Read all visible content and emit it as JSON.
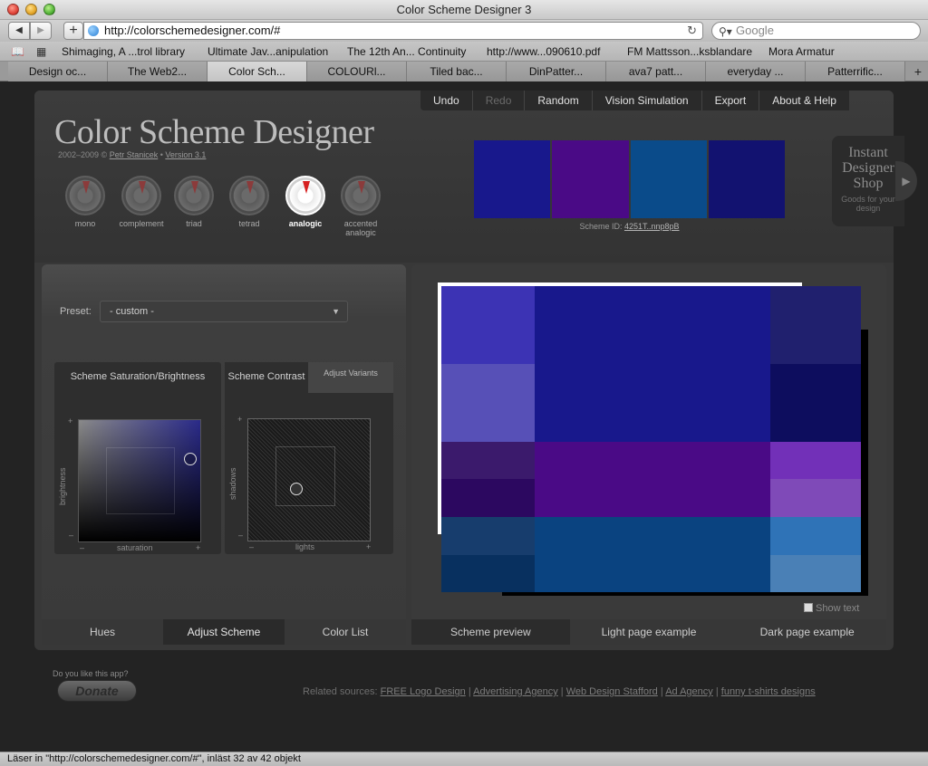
{
  "browser": {
    "window_title": "Color Scheme Designer 3",
    "url": "http://colorschemedesigner.com/#",
    "search_placeholder": "Google",
    "bookmarks": [
      "Shimaging, A ...trol library",
      "Ultimate Jav...anipulation",
      "The 12th An... Continuity",
      "http://www...090610.pdf",
      "FM Mattsson...ksblandare",
      "Mora Armatur"
    ],
    "tabs": [
      "Design oc...",
      "The Web2...",
      "Color Sch...",
      "COLOURl...",
      "Tiled bac...",
      "DinPatter...",
      "ava7 patt...",
      "everyday ...",
      "Patterrific..."
    ],
    "status": "Läser in \"http://colorschemedesigner.com/#\", inläst 32 av 42 objekt"
  },
  "menu": {
    "items": [
      "Undo",
      "Redo",
      "Random",
      "Vision Simulation",
      "Export",
      "About & Help"
    ]
  },
  "header": {
    "logo": "Color Scheme Designer",
    "credits_prefix": "2002–2009 ©",
    "author": "Petr Stanicek",
    "version": "Version 3.1",
    "modes": [
      "mono",
      "complement",
      "triad",
      "tetrad",
      "analogic",
      "accented analogic"
    ],
    "scheme_id_label": "Scheme ID:",
    "scheme_id": "4251T..nnp8pB",
    "shop_title": "Instant Designer Shop",
    "shop_sub": "Goods for your design"
  },
  "swatches": [
    "#18188c",
    "#4a0a86",
    "#0a4b8a",
    "#121270"
  ],
  "left": {
    "preset_label": "Preset:",
    "preset_value": "- custom -",
    "sb_title": "Scheme Saturation/Brightness",
    "sb_xlabel": "saturation",
    "sb_ylabel": "brightness",
    "contrast_title": "Scheme Contrast",
    "adjust_variants": "Adjust Variants",
    "contrast_xlabel": "lights",
    "contrast_ylabel": "shadows",
    "plus": "+",
    "minus": "–",
    "tabs": [
      "Hues",
      "Adjust Scheme",
      "Color List"
    ]
  },
  "right": {
    "show_text": "Show text",
    "tabs": [
      "Scheme preview",
      "Light page example",
      "Dark page example"
    ]
  },
  "footer": {
    "donate_question": "Do you like this app?",
    "donate": "Donate",
    "related_label": "Related sources:",
    "links": [
      "FREE Logo Design",
      "Advertising Agency",
      "Web Design Stafford",
      "Ad Agency",
      "funny t-shirts designs"
    ]
  }
}
